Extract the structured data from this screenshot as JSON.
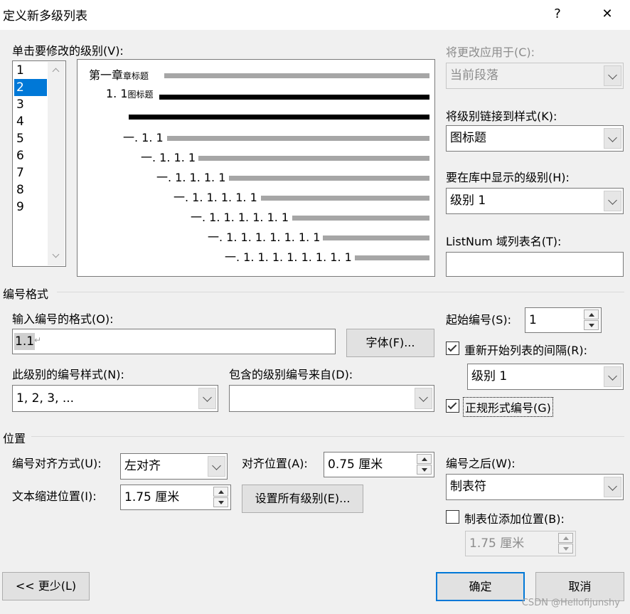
{
  "window": {
    "title": "定义新多级列表",
    "help": "?",
    "close": "✕"
  },
  "level_section": {
    "label": "单击要修改的级别(V):",
    "levels": [
      "1",
      "2",
      "3",
      "4",
      "5",
      "6",
      "7",
      "8",
      "9"
    ],
    "selected": "2"
  },
  "preview": {
    "rows": [
      {
        "num": "第一章",
        "style": "章标题"
      },
      {
        "num": "1. 1",
        "style": "图标题"
      },
      {
        "num": "",
        "style": ""
      },
      {
        "num": "一. 1. 1",
        "style": ""
      },
      {
        "num": "一. 1. 1. 1",
        "style": ""
      },
      {
        "num": "一. 1. 1. 1. 1",
        "style": ""
      },
      {
        "num": "一. 1. 1. 1. 1. 1",
        "style": ""
      },
      {
        "num": "一. 1. 1. 1. 1. 1. 1",
        "style": ""
      },
      {
        "num": "一. 1. 1. 1. 1. 1. 1. 1",
        "style": ""
      },
      {
        "num": "一. 1. 1. 1. 1. 1. 1. 1. 1",
        "style": ""
      }
    ]
  },
  "right_panel": {
    "apply_to_label": "将更改应用于(C):",
    "apply_to_value": "当前段落",
    "link_style_label": "将级别链接到样式(K):",
    "link_style_value": "图标题",
    "gallery_level_label": "要在库中显示的级别(H):",
    "gallery_level_value": "级别 1",
    "listnum_label": "ListNum 域列表名(T):",
    "listnum_value": ""
  },
  "number_format": {
    "section_label": "编号格式",
    "format_label": "输入编号的格式(O):",
    "format_value": "1.1",
    "format_mark": "↵",
    "font_button": "字体(F)...",
    "style_label": "此级别的编号样式(N):",
    "style_value": "1, 2, 3, ...",
    "include_label": "包含的级别编号来自(D):",
    "include_value": "",
    "start_label": "起始编号(S):",
    "start_value": "1",
    "restart_label": "重新开始列表的间隔(R):",
    "restart_checked": true,
    "restart_value": "级别 1",
    "legal_label": "正规形式编号(G)",
    "legal_checked": true
  },
  "position": {
    "section_label": "位置",
    "align_label": "编号对齐方式(U):",
    "align_value": "左对齐",
    "align_at_label": "对齐位置(A):",
    "align_at_value": "0.75 厘米",
    "indent_label": "文本缩进位置(I):",
    "indent_value": "1.75 厘米",
    "set_all_button": "设置所有级别(E)...",
    "follow_label": "编号之后(W):",
    "follow_value": "制表符",
    "tab_stop_label": "制表位添加位置(B):",
    "tab_stop_checked": false,
    "tab_stop_value": "1.75 厘米"
  },
  "footer": {
    "less_button": "<< 更少(L)",
    "ok_button": "确定",
    "cancel_button": "取消",
    "watermark": "CSDN @Hellofijunshy"
  },
  "colors": {
    "accent": "#0078d7",
    "disabled_text": "#8c8c8c",
    "preview_bar": "#a6a6a6"
  }
}
